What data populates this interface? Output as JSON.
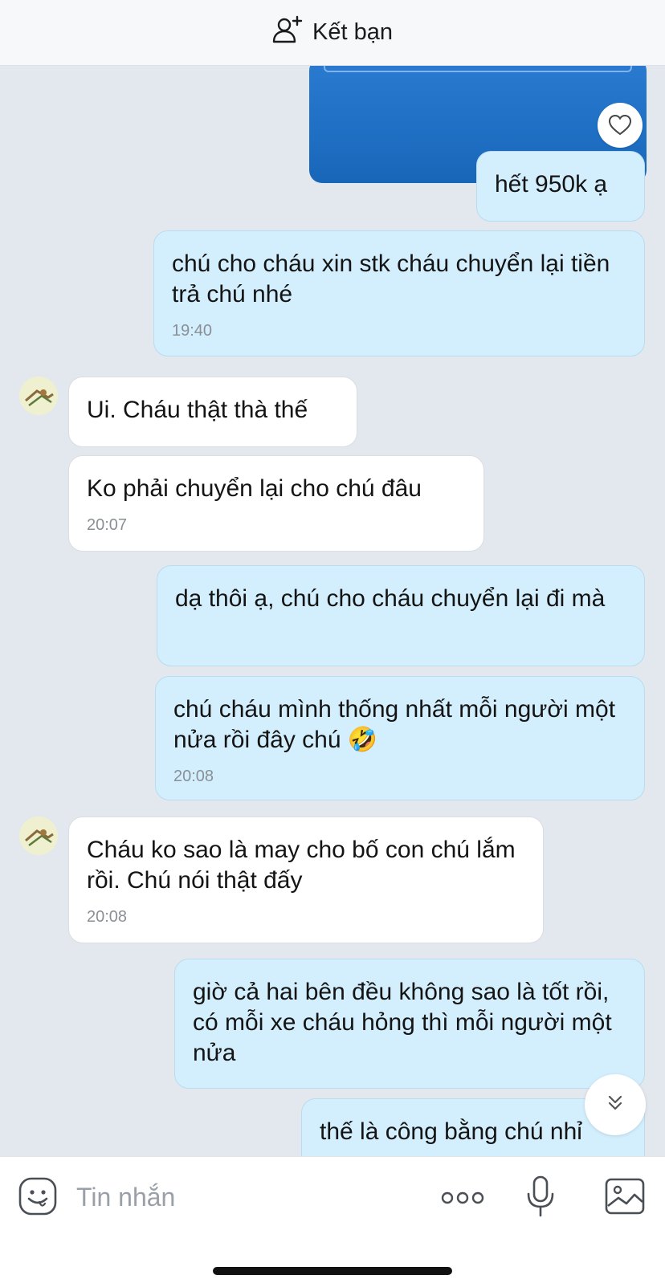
{
  "header": {
    "add_friend_label": "Kết bạn"
  },
  "messages": [
    {
      "text": "hết 950k ạ",
      "time": ""
    },
    {
      "text": "chú cho cháu xin stk cháu chuyển lại tiền trả chú nhé",
      "time": "19:40"
    },
    {
      "text": "Ui. Cháu thật thà thế",
      "time": ""
    },
    {
      "text": "Ko phải chuyển lại cho chú đâu",
      "time": "20:07"
    },
    {
      "text": "dạ thôi ạ, chú cho cháu chuyển lại đi mà",
      "time": ""
    },
    {
      "text": "chú cháu mình thống nhất mỗi người một nửa rồi đây chú 🤣",
      "time": "20:08"
    },
    {
      "text": "Cháu ko sao là may cho bố con chú lắm rồi. Chú nói thật đấy",
      "time": "20:08"
    },
    {
      "text": "giờ cả hai bên đều không sao là tốt rồi, có mỗi xe cháu hỏng thì mỗi người một nửa",
      "time": ""
    },
    {
      "text": "thế là công bằng chú nhỉ",
      "time": ""
    }
  ],
  "composer": {
    "placeholder": "Tin nhắn"
  },
  "colors": {
    "background": "#e3e7ee",
    "my_bubble": "#d3effd",
    "their_bubble": "#ffffff",
    "image_blue": "#1f6fc4"
  },
  "icons": {
    "header": "add-user-icon",
    "reaction": "heart-icon",
    "scroll": "double-chevron-down-icon",
    "composer": [
      "sticker-icon",
      "more-icon",
      "microphone-icon",
      "image-icon"
    ]
  }
}
